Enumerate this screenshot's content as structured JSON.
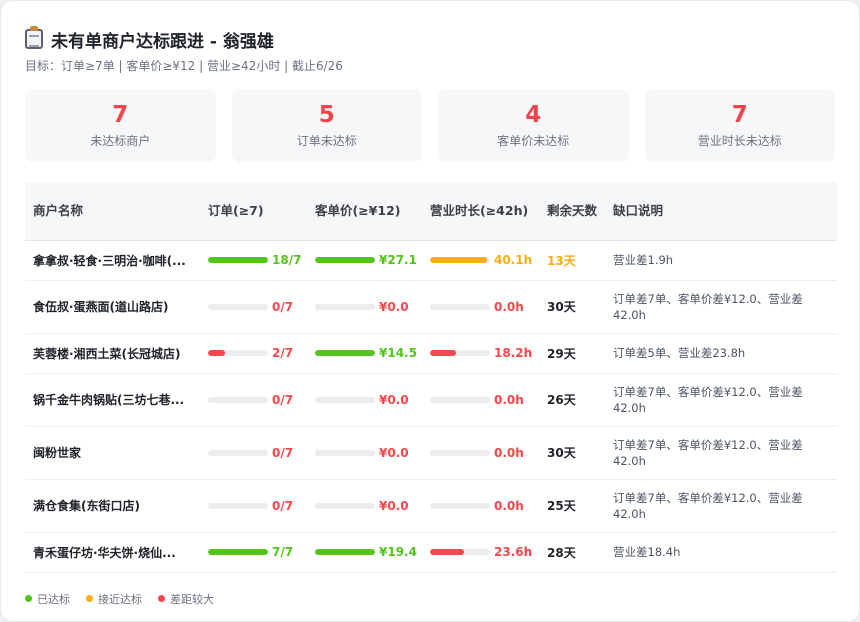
{
  "header": {
    "title": "未有单商户达标跟进 - 翁强雄",
    "subtitle": "目标：订单≥7单 | 客单价≥¥12 | 营业≥42小时 | 截止6/26"
  },
  "stats": [
    {
      "value": "7",
      "label": "未达标商户"
    },
    {
      "value": "5",
      "label": "订单未达标"
    },
    {
      "value": "4",
      "label": "客单价未达标"
    },
    {
      "value": "7",
      "label": "营业时长未达标"
    }
  ],
  "table": {
    "headers": [
      "商户名称",
      "订单(≥7)",
      "客单价(≥¥12)",
      "营业时长(≥42h)",
      "剩余天数",
      "缺口说明"
    ],
    "rows": [
      {
        "name": "拿拿叔·轻食·三明治·咖啡(...",
        "orders": {
          "text": "18/7",
          "fraction": 1.0,
          "status": "good"
        },
        "price": {
          "text": "¥27.1",
          "fraction": 1.0,
          "status": "good"
        },
        "hours": {
          "text": "40.1h",
          "fraction": 0.95,
          "status": "near"
        },
        "days": "13天",
        "days_status": "near",
        "note": "营业差1.9h"
      },
      {
        "name": "食伍叔·蛋燕面(道山路店)",
        "orders": {
          "text": "0/7",
          "fraction": 0,
          "status": "bad"
        },
        "price": {
          "text": "¥0.0",
          "fraction": 0,
          "status": "bad"
        },
        "hours": {
          "text": "0.0h",
          "fraction": 0,
          "status": "bad"
        },
        "days": "30天",
        "days_status": "normal",
        "note": "订单差7单、客单价差¥12.0、营业差42.0h"
      },
      {
        "name": "芙蓉楼·湘西土菜(长冠城店)",
        "orders": {
          "text": "2/7",
          "fraction": 0.29,
          "status": "bad"
        },
        "price": {
          "text": "¥14.5",
          "fraction": 1.0,
          "status": "good"
        },
        "hours": {
          "text": "18.2h",
          "fraction": 0.43,
          "status": "bad"
        },
        "days": "29天",
        "days_status": "normal",
        "note": "订单差5单、营业差23.8h"
      },
      {
        "name": "锅千金牛肉锅贴(三坊七巷...",
        "orders": {
          "text": "0/7",
          "fraction": 0,
          "status": "bad"
        },
        "price": {
          "text": "¥0.0",
          "fraction": 0,
          "status": "bad"
        },
        "hours": {
          "text": "0.0h",
          "fraction": 0,
          "status": "bad"
        },
        "days": "26天",
        "days_status": "normal",
        "note": "订单差7单、客单价差¥12.0、营业差42.0h"
      },
      {
        "name": "闽粉世家",
        "orders": {
          "text": "0/7",
          "fraction": 0,
          "status": "bad"
        },
        "price": {
          "text": "¥0.0",
          "fraction": 0,
          "status": "bad"
        },
        "hours": {
          "text": "0.0h",
          "fraction": 0,
          "status": "bad"
        },
        "days": "30天",
        "days_status": "normal",
        "note": "订单差7单、客单价差¥12.0、营业差42.0h"
      },
      {
        "name": "满仓食集(东街口店)",
        "orders": {
          "text": "0/7",
          "fraction": 0,
          "status": "bad"
        },
        "price": {
          "text": "¥0.0",
          "fraction": 0,
          "status": "bad"
        },
        "hours": {
          "text": "0.0h",
          "fraction": 0,
          "status": "bad"
        },
        "days": "25天",
        "days_status": "normal",
        "note": "订单差7单、客单价差¥12.0、营业差42.0h"
      },
      {
        "name": "青禾蛋仔坊·华夫饼·烧仙...",
        "orders": {
          "text": "7/7",
          "fraction": 1.0,
          "status": "good"
        },
        "price": {
          "text": "¥19.4",
          "fraction": 1.0,
          "status": "good"
        },
        "hours": {
          "text": "23.6h",
          "fraction": 0.56,
          "status": "bad"
        },
        "days": "28天",
        "days_status": "normal",
        "note": "营业差18.4h"
      }
    ]
  },
  "legend": [
    {
      "label": "已达标",
      "status": "good"
    },
    {
      "label": "接近达标",
      "status": "near"
    },
    {
      "label": "差距较大",
      "status": "bad"
    }
  ],
  "colors": {
    "good": "#52c41a",
    "near": "#faad14",
    "bad": "#f5474c",
    "normal": "#1f2329"
  }
}
